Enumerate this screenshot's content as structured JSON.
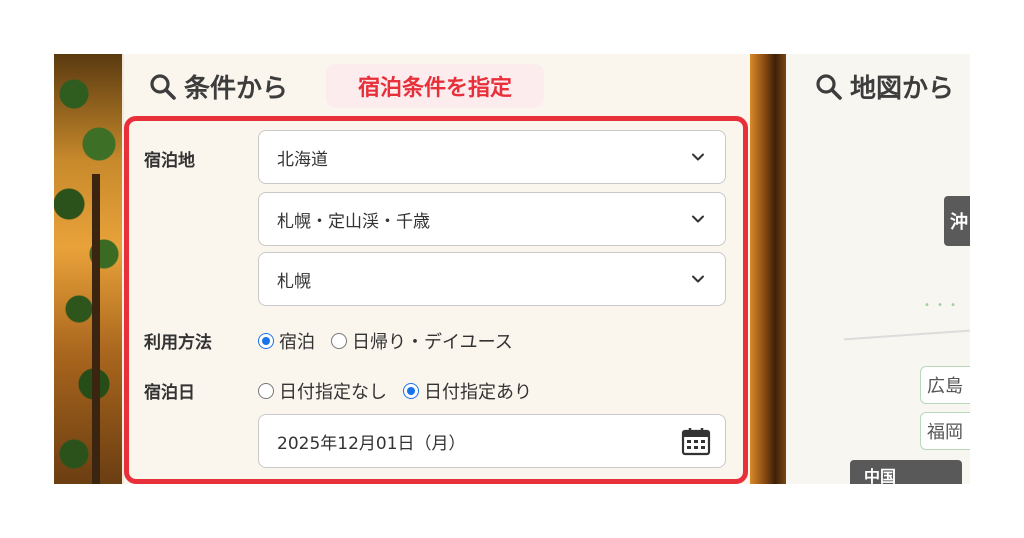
{
  "search_panel": {
    "title": "条件から探す",
    "title_visible": "条件から"
  },
  "map_panel": {
    "title": "地図から"
  },
  "callout": {
    "text": "宿泊条件を指定",
    "color": "#e8303a"
  },
  "form": {
    "location_label": "宿泊地",
    "prefecture": "北海道",
    "area": "札幌・定山渓・千歳",
    "sub_area": "札幌",
    "usage_label": "利用方法",
    "usage_options": [
      "宿泊",
      "日帰り・デイユース"
    ],
    "usage_selected": "宿泊",
    "date_label": "宿泊日",
    "date_options": [
      "日付指定なし",
      "日付指定あり"
    ],
    "date_selected": "日付指定あり",
    "date_value": "2025年12月01日（月）"
  },
  "map": {
    "prefecture_tag": "沖",
    "chips": [
      "広島",
      "福岡"
    ],
    "region_button": "中国"
  },
  "icons": {
    "search": "search-icon",
    "chevron": "chevron-down-icon",
    "calendar": "calendar-icon"
  },
  "colors": {
    "radio_selected": "#1a73e8",
    "highlight": "#e8303a"
  }
}
